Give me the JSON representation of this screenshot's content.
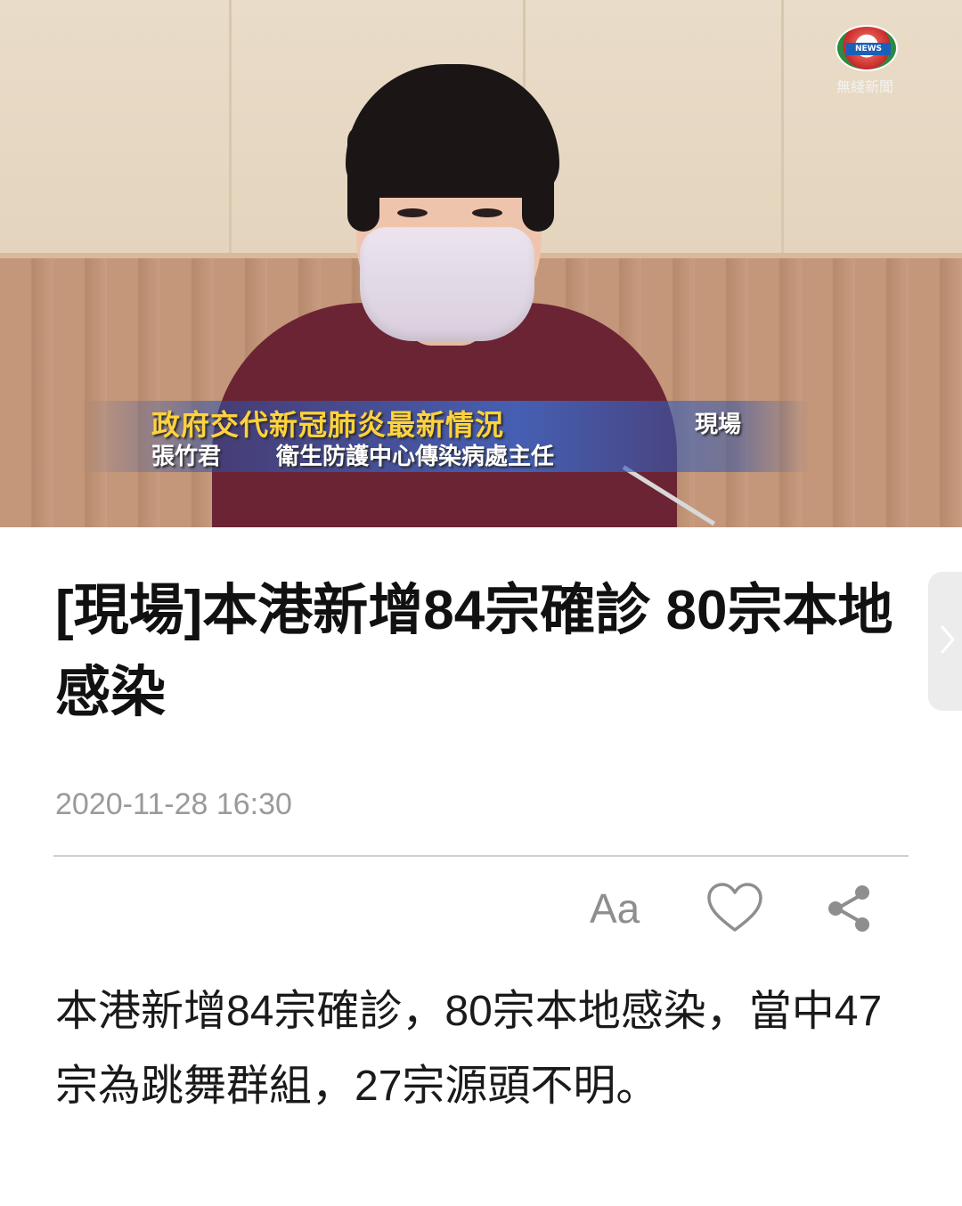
{
  "video": {
    "caption_title": "政府交代新冠肺炎最新情況",
    "caption_tag": "現場",
    "caption_name": "張竹君",
    "caption_role": "衛生防護中心傳染病處主任",
    "logo_badge_text": "NEWS",
    "logo_text": "無綫新聞"
  },
  "article": {
    "headline": "[現場]本港新增84宗確診 80宗本地感染",
    "timestamp": "2020-11-28 16:30",
    "body": "本港新增84宗確診，80宗本地感染，當中47宗為跳舞群組，27宗源頭不明。"
  },
  "toolbar": {
    "font_size_label": "Aa",
    "icons": [
      "font-size-icon",
      "heart-icon",
      "share-icon"
    ]
  },
  "next_tab": {
    "icon": "chevron-right-icon"
  },
  "colors": {
    "caption_title": "#ffd23e",
    "timestamp": "#9a9a9a",
    "icon_gray": "#8e8e8e",
    "sweater": "#6b2434"
  }
}
